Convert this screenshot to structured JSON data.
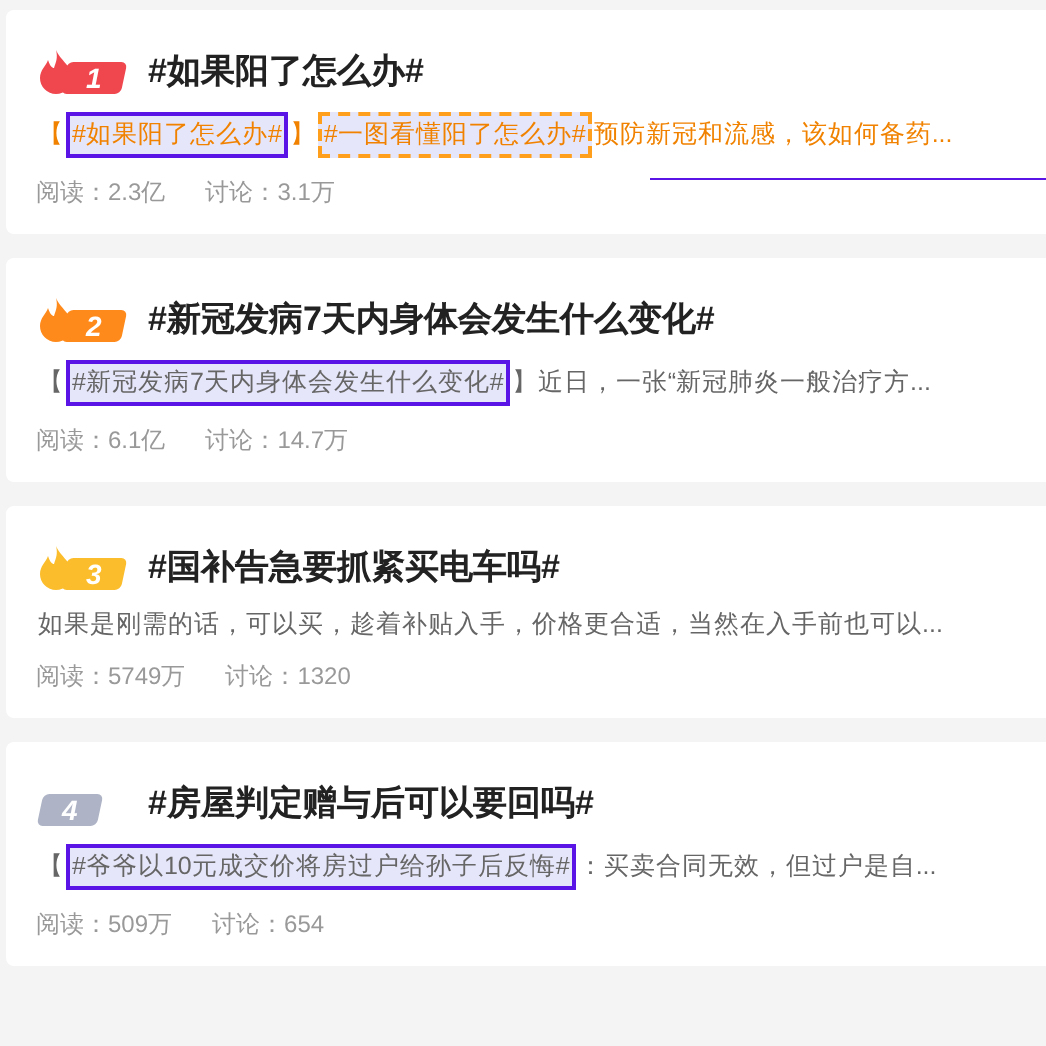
{
  "topics": [
    {
      "rank": "1",
      "color": "#f0474f",
      "flame": true,
      "title": "#如果阳了怎么办#",
      "accent": true,
      "underline": true,
      "summary": [
        {
          "kind": "plain",
          "text": "【"
        },
        {
          "kind": "tag",
          "text": "#如果阳了怎么办#",
          "dashed": false
        },
        {
          "kind": "plain",
          "text": "】"
        },
        {
          "kind": "tag",
          "text": "#一图看懂阳了怎么办#",
          "dashed": true
        },
        {
          "kind": "plain",
          "text": "预防新冠和流感，该如何备药..."
        }
      ],
      "reads": "阅读：2.3亿",
      "discussions": "讨论：3.1万"
    },
    {
      "rank": "2",
      "color": "#ff8a1c",
      "flame": true,
      "title": "#新冠发病7天内身体会发生什么变化#",
      "accent": false,
      "underline": false,
      "summary": [
        {
          "kind": "plain",
          "text": "【"
        },
        {
          "kind": "tag",
          "text": "#新冠发病7天内身体会发生什么变化#",
          "dashed": false
        },
        {
          "kind": "plain",
          "text": "】近日，一张“新冠肺炎一般治疗方..."
        }
      ],
      "reads": "阅读：6.1亿",
      "discussions": "讨论：14.7万"
    },
    {
      "rank": "3",
      "color": "#fbbd2c",
      "flame": true,
      "title": "#国补告急要抓紧买电车吗#",
      "accent": false,
      "underline": false,
      "summary": [
        {
          "kind": "plain",
          "text": "如果是刚需的话，可以买，趁着补贴入手，价格更合适，当然在入手前也可以..."
        }
      ],
      "reads": "阅读：5749万",
      "discussions": "讨论：1320"
    },
    {
      "rank": "4",
      "color": "#aeb4c6",
      "flame": false,
      "title": "#房屋判定赠与后可以要回吗#",
      "accent": false,
      "underline": false,
      "summary": [
        {
          "kind": "plain",
          "text": "【"
        },
        {
          "kind": "tag",
          "text": "#爷爷以10元成交价将房过户给孙子后反悔#",
          "dashed": false
        },
        {
          "kind": "plain",
          "text": "：买卖合同无效，但过户是自..."
        }
      ],
      "reads": "阅读：509万",
      "discussions": "讨论：654"
    }
  ]
}
